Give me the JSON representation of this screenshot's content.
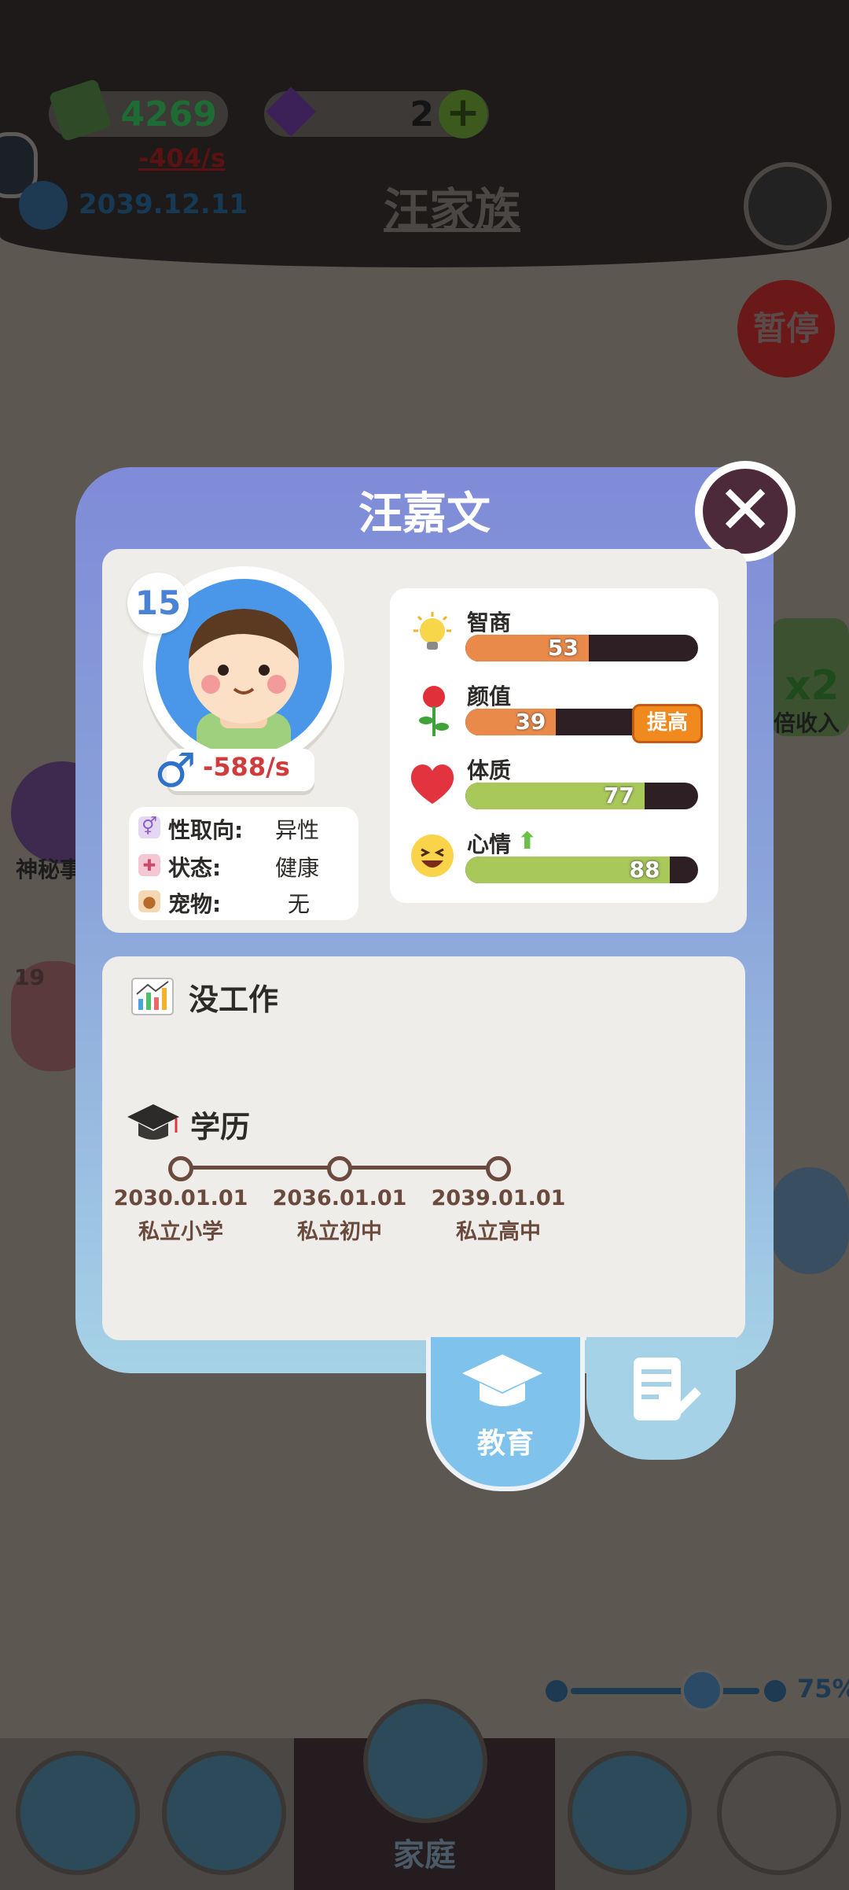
{
  "hud": {
    "money": "4269",
    "money_rate": "-404/s",
    "gems": "2",
    "date": "2039.12.11",
    "family_name": "汪家族",
    "pause_label": "暂停",
    "double_income_label": "倍收入",
    "double_income_multiplier": "x2",
    "mystery_label": "神秘事",
    "side_character_age": "19",
    "zoom_percent": "75%",
    "zoom_level": 0.75
  },
  "bottom_nav": {
    "active_label": "家庭"
  },
  "modal": {
    "title": "汪嘉文",
    "age": "15",
    "income": "-588/s",
    "info": [
      {
        "label": "性取向:",
        "value": "异性"
      },
      {
        "label": "状态:",
        "value": "健康"
      },
      {
        "label": "宠物:",
        "value": "无"
      }
    ],
    "stats": [
      {
        "label": "智商",
        "value": "53",
        "pct": 0.53,
        "color": "#e98a4a"
      },
      {
        "label": "颜值",
        "value": "39",
        "pct": 0.39,
        "color": "#e98a4a"
      },
      {
        "label": "体质",
        "value": "77",
        "pct": 0.77,
        "color": "#a8c85a"
      },
      {
        "label": "心情",
        "value": "88",
        "pct": 0.88,
        "color": "#a8c85a"
      }
    ],
    "upgrade_label": "提高",
    "job_title": "没工作",
    "education_title": "学历",
    "education": [
      {
        "date": "2030.01.01",
        "school": "私立小学"
      },
      {
        "date": "2036.01.01",
        "school": "私立初中"
      },
      {
        "date": "2039.01.01",
        "school": "私立高中"
      }
    ],
    "tab_education_label": "教育"
  },
  "colors": {
    "modal_top": "#7f8bd8",
    "modal_bottom": "#a6d2e7",
    "close_button": "#4d2a3a",
    "income_negative": "#d03c3c",
    "education_text": "#6b4a3e"
  }
}
